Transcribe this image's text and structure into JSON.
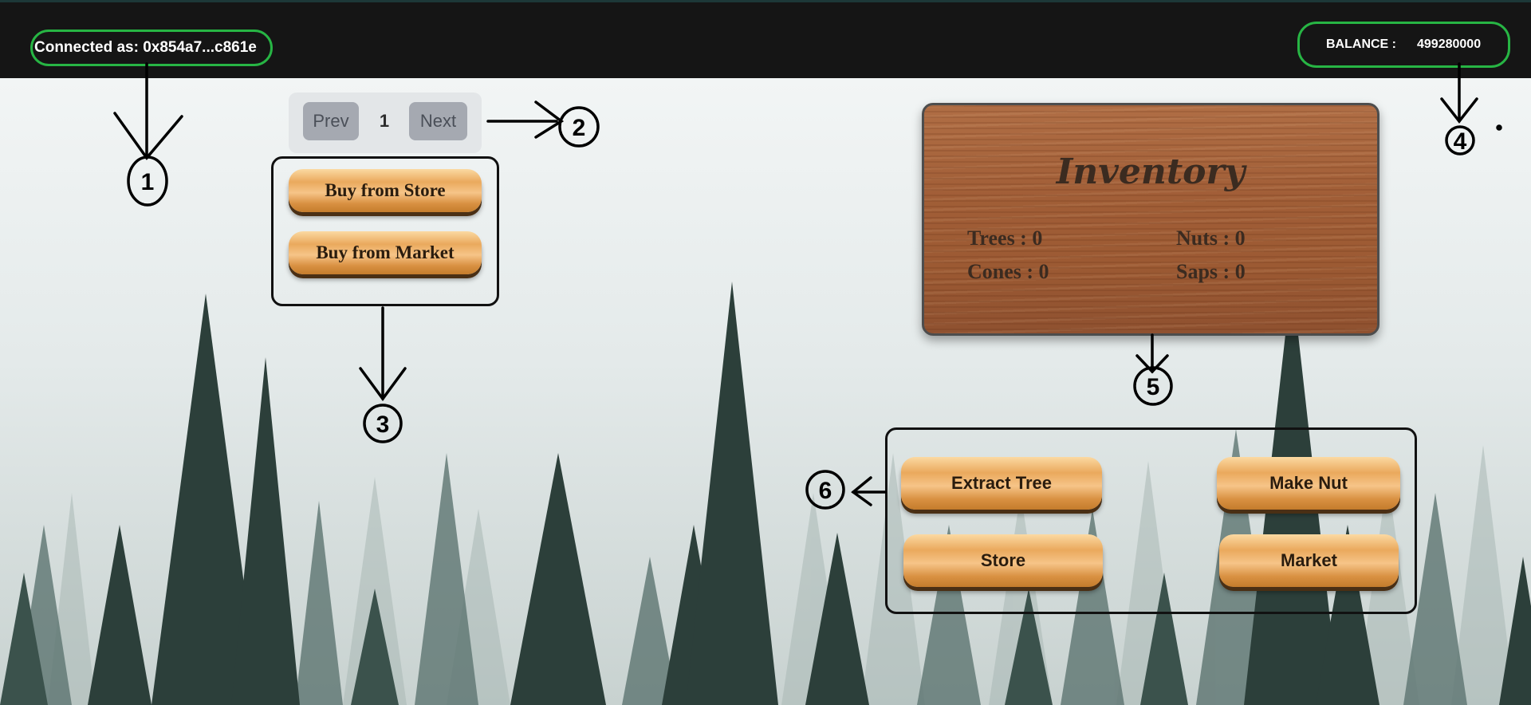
{
  "header": {
    "connected_text": "Connected as: 0x854a7...c861e",
    "balance_label": "BALANCE :",
    "balance_value": "499280000"
  },
  "pagination": {
    "prev_label": "Prev",
    "page_number": "1",
    "next_label": "Next"
  },
  "buy_buttons": {
    "store_label": "Buy from Store",
    "market_label": "Buy from Market"
  },
  "inventory": {
    "title": "Inventory",
    "items": [
      {
        "label": "Trees : 0"
      },
      {
        "label": "Nuts : 0"
      },
      {
        "label": "Cones : 0"
      },
      {
        "label": "Saps : 0"
      }
    ]
  },
  "actions": {
    "extract_tree": "Extract Tree",
    "make_nut": "Make Nut",
    "store": "Store",
    "market": "Market"
  },
  "annotations": [
    "1",
    "2",
    "3",
    "4",
    "5",
    "6"
  ],
  "colors": {
    "highlight": "#27b544",
    "topbar": "#151515",
    "wood_button": "#eaa95d",
    "inventory_wood": "#a15e37"
  }
}
